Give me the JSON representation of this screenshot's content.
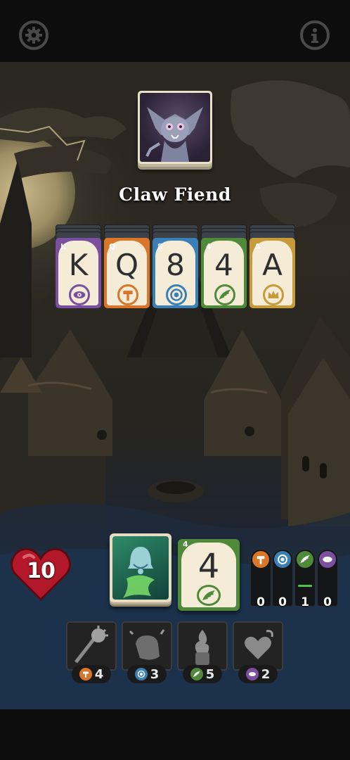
{
  "header": {
    "settings_icon": "gear-icon",
    "info_icon": "info-icon"
  },
  "enemy": {
    "name": "Claw Fiend",
    "portrait_icon": "bat-creature-icon"
  },
  "enemy_cards": [
    {
      "rank": "K",
      "corner": "K",
      "suit": "eye",
      "color": "#7b4fa0"
    },
    {
      "rank": "Q",
      "corner": "Q",
      "suit": "hammer",
      "color": "#d9762a"
    },
    {
      "rank": "8",
      "corner": "8",
      "suit": "shield",
      "color": "#3a7fb5"
    },
    {
      "rank": "4",
      "corner": "4",
      "suit": "wing",
      "color": "#4f8a3a"
    },
    {
      "rank": "A",
      "corner": "A",
      "suit": "crown",
      "color": "#c79a3a"
    }
  ],
  "player": {
    "health": "10",
    "deck_icon": "bell-ghost-icon",
    "played_card": {
      "rank": "4",
      "corner": "4",
      "suit": "wing",
      "color": "#4f8a3a"
    }
  },
  "resources": [
    {
      "suit": "hammer",
      "color": "#d9762a",
      "count": "0",
      "level": 0
    },
    {
      "suit": "shield",
      "color": "#3a7fb5",
      "count": "0",
      "level": 0
    },
    {
      "suit": "wing",
      "color": "#4f8a3a",
      "count": "1",
      "level": 0.25
    },
    {
      "suit": "eye",
      "color": "#7b4fa0",
      "count": "0",
      "level": 0
    }
  ],
  "abilities": [
    {
      "icon": "mace-icon",
      "suit": "hammer",
      "color": "#d9762a",
      "cost": "4"
    },
    {
      "icon": "fist-icon",
      "suit": "shield",
      "color": "#3a7fb5",
      "cost": "3"
    },
    {
      "icon": "flame-hand-icon",
      "suit": "wing",
      "color": "#4f8a3a",
      "cost": "5"
    },
    {
      "icon": "heart-potion-icon",
      "suit": "eye",
      "color": "#7b4fa0",
      "cost": "2"
    }
  ]
}
